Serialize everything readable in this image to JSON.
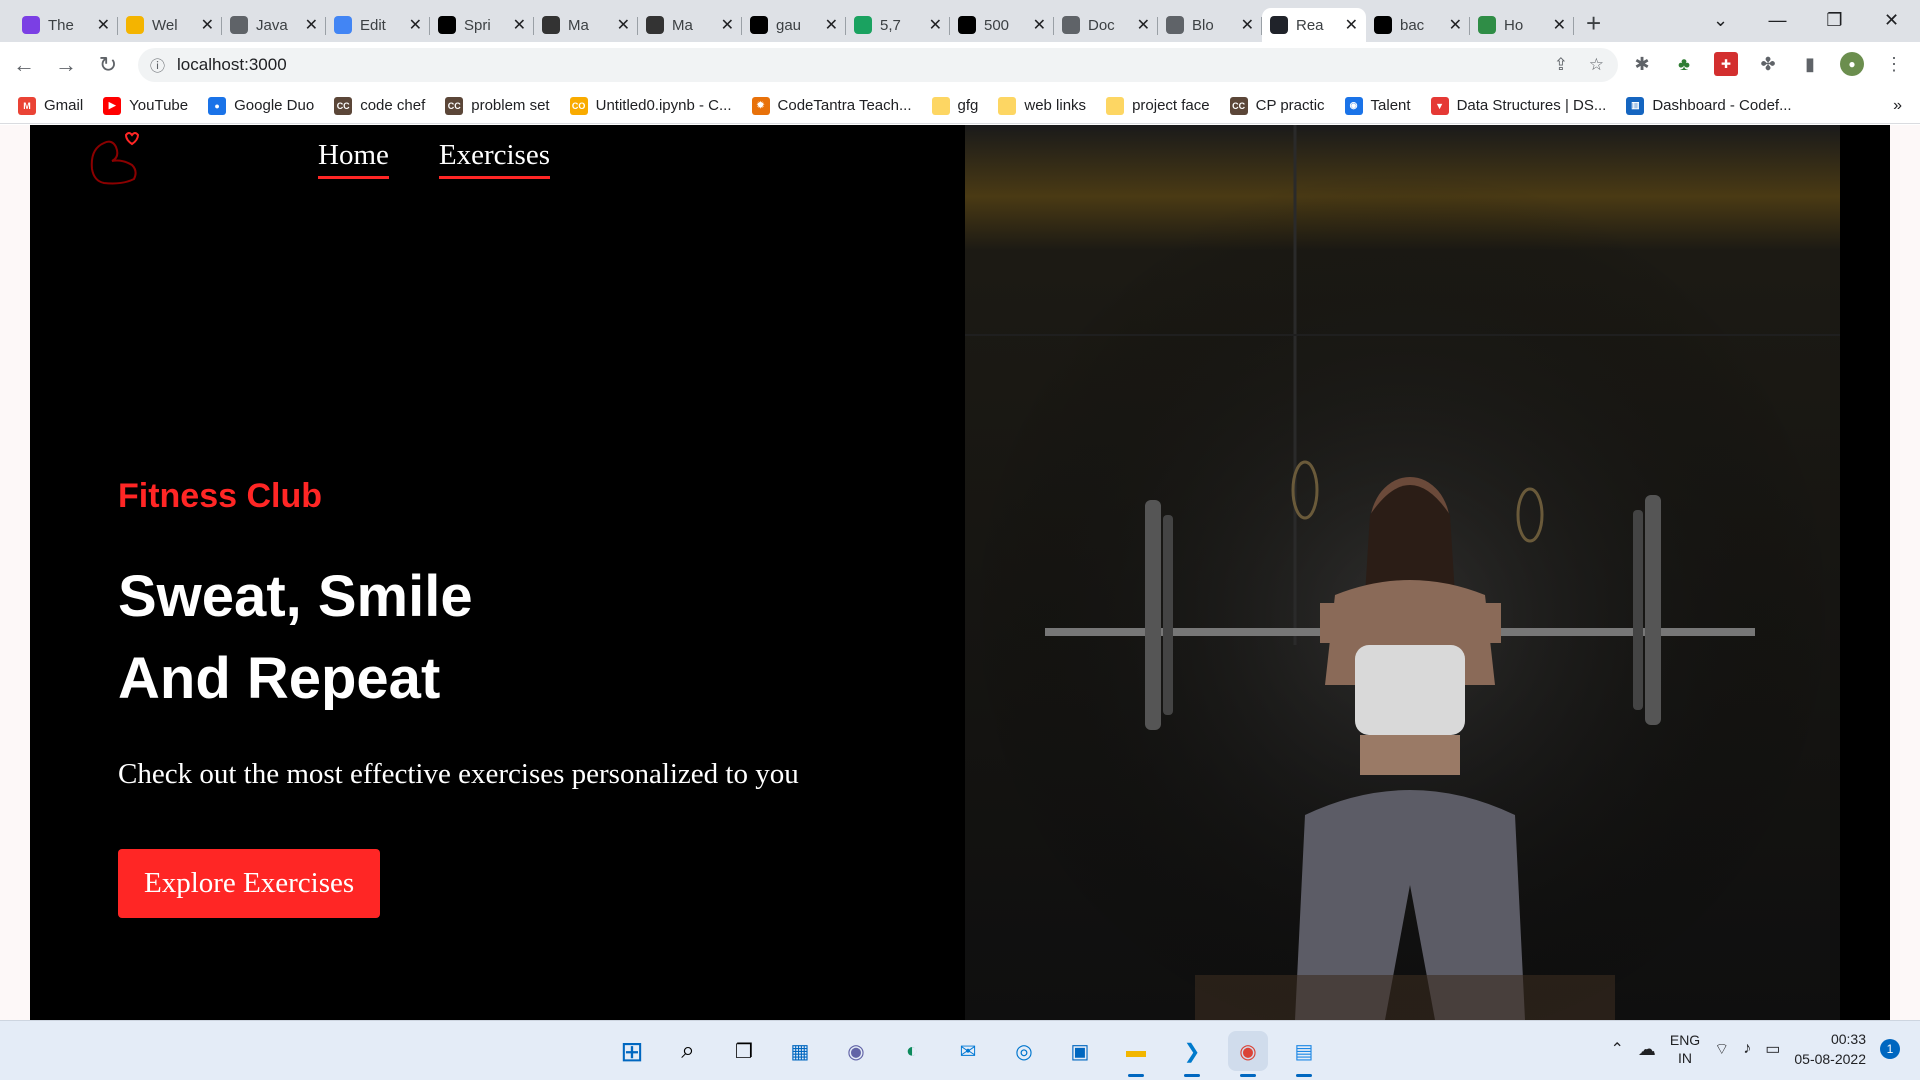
{
  "browser": {
    "tabs": [
      {
        "title": "The",
        "icon": "u-badge-icon",
        "color": "#7b3fe4"
      },
      {
        "title": "Wel",
        "icon": "doc-icon",
        "color": "#f4b400"
      },
      {
        "title": "Java",
        "icon": "globe-icon",
        "color": "#5f6368"
      },
      {
        "title": "Edit",
        "icon": "cloud-icon",
        "color": "#4285f4"
      },
      {
        "title": "Spri",
        "icon": "medium-icon",
        "color": "#000000"
      },
      {
        "title": "Ma",
        "icon": "chevron-icon",
        "color": "#333333"
      },
      {
        "title": "Ma",
        "icon": "chevron-icon",
        "color": "#333333"
      },
      {
        "title": "gau",
        "icon": "github-icon",
        "color": "#000000"
      },
      {
        "title": "5,7",
        "icon": "p-icon",
        "color": "#1aa260"
      },
      {
        "title": "500",
        "icon": "block-icon",
        "color": "#000000"
      },
      {
        "title": "Doc",
        "icon": "globe-icon",
        "color": "#5f6368"
      },
      {
        "title": "Blo",
        "icon": "globe-icon",
        "color": "#5f6368"
      },
      {
        "title": "Rea",
        "icon": "react-icon",
        "color": "#20232a",
        "active": true
      },
      {
        "title": "bac",
        "icon": "medium-icon",
        "color": "#000000"
      },
      {
        "title": "Ho",
        "icon": "gfg-icon",
        "color": "#2f8d46"
      }
    ],
    "new_tab": "+",
    "url": "localhost:3000"
  },
  "bookmarks": [
    {
      "label": "Gmail",
      "color": "#ea4335",
      "glyph": "M"
    },
    {
      "label": "YouTube",
      "color": "#ff0000",
      "glyph": "▶"
    },
    {
      "label": "Google Duo",
      "color": "#1a73e8",
      "glyph": "●"
    },
    {
      "label": "code chef",
      "color": "#5b4638",
      "glyph": "CC"
    },
    {
      "label": "problem set",
      "color": "#5b4638",
      "glyph": "CC"
    },
    {
      "label": "Untitled0.ipynb - C...",
      "color": "#f9ab00",
      "glyph": "CO"
    },
    {
      "label": "CodeTantra Teach...",
      "color": "#e8710a",
      "glyph": "✹"
    },
    {
      "label": "gfg",
      "color": "#fdd663",
      "glyph": ""
    },
    {
      "label": "web links",
      "color": "#fdd663",
      "glyph": ""
    },
    {
      "label": "project face",
      "color": "#fdd663",
      "glyph": ""
    },
    {
      "label": "CP practic",
      "color": "#5b4638",
      "glyph": "CC"
    },
    {
      "label": "Talent",
      "color": "#1a73e8",
      "glyph": "◉"
    },
    {
      "label": "Data Structures | DS...",
      "color": "#e53935",
      "glyph": "▼"
    },
    {
      "label": "Dashboard - Codef...",
      "color": "#1565c0",
      "glyph": "▥"
    }
  ],
  "bookmarks_more": "»",
  "app": {
    "nav": {
      "home": "Home",
      "exercises": "Exercises"
    },
    "hero": {
      "eyebrow": "Fitness Club",
      "headline_line1": "Sweat, Smile",
      "headline_line2": "And Repeat",
      "subtitle": "Check out the most effective exercises personalized to you",
      "cta": "Explore Exercises"
    },
    "accent_color": "#ff2625"
  },
  "taskbar": {
    "language": "ENG",
    "region": "IN",
    "time": "00:33",
    "date": "05-08-2022",
    "notifications": "1"
  }
}
